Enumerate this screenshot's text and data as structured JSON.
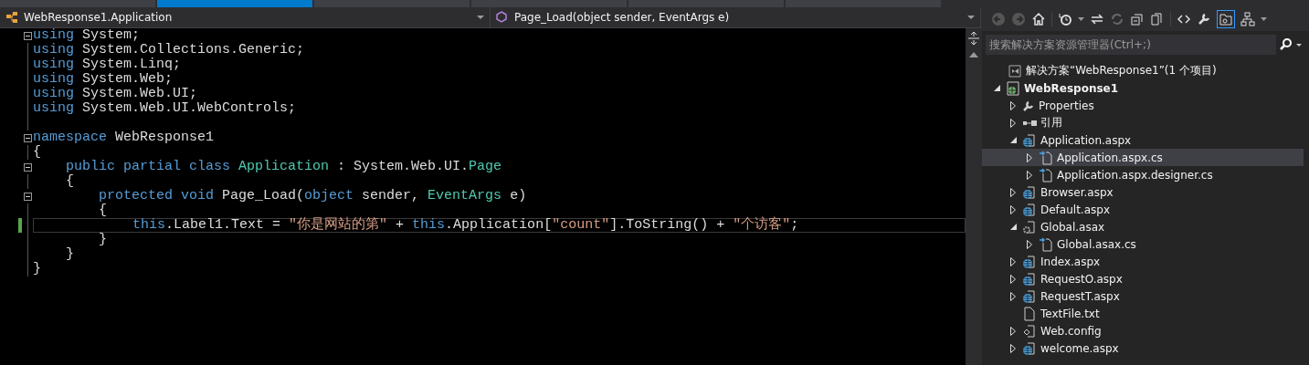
{
  "editor_tabs": [
    {
      "selected": false
    },
    {
      "selected": true
    },
    {
      "selected": false
    },
    {
      "selected": false
    },
    {
      "selected": false
    },
    {
      "selected": false
    }
  ],
  "navigation_bar": {
    "class_dropdown": "WebResponse1.Application",
    "member_dropdown": "Page_Load(object sender, EventArgs e)"
  },
  "code_lines": [
    {
      "foldable": true,
      "current": false,
      "tokens": [
        {
          "kind": "keyword",
          "text": "using"
        },
        {
          "kind": "plain",
          "text": " System;"
        }
      ]
    },
    {
      "foldable": false,
      "current": false,
      "tokens": [
        {
          "kind": "keyword",
          "text": "using"
        },
        {
          "kind": "plain",
          "text": " System.Collections.Generic;"
        }
      ]
    },
    {
      "foldable": false,
      "current": false,
      "tokens": [
        {
          "kind": "keyword",
          "text": "using"
        },
        {
          "kind": "plain",
          "text": " System.Linq;"
        }
      ]
    },
    {
      "foldable": false,
      "current": false,
      "tokens": [
        {
          "kind": "keyword",
          "text": "using"
        },
        {
          "kind": "plain",
          "text": " System.Web;"
        }
      ]
    },
    {
      "foldable": false,
      "current": false,
      "tokens": [
        {
          "kind": "keyword",
          "text": "using"
        },
        {
          "kind": "plain",
          "text": " System.Web.UI;"
        }
      ]
    },
    {
      "foldable": false,
      "current": false,
      "tokens": [
        {
          "kind": "keyword",
          "text": "using"
        },
        {
          "kind": "plain",
          "text": " System.Web.UI.WebControls;"
        }
      ]
    },
    {
      "foldable": false,
      "current": false
    },
    {
      "foldable": true,
      "current": false,
      "tokens": [
        {
          "kind": "keyword",
          "text": "namespace"
        },
        {
          "kind": "plain",
          "text": " WebResponse1"
        }
      ]
    },
    {
      "foldable": false,
      "current": false,
      "tokens": [
        {
          "kind": "plain",
          "text": "{"
        }
      ]
    },
    {
      "foldable": true,
      "current": false,
      "tokens": [
        {
          "kind": "keyword",
          "text": "    public partial class "
        },
        {
          "kind": "type",
          "text": "Application"
        },
        {
          "kind": "plain",
          "text": " : System.Web.UI."
        },
        {
          "kind": "type",
          "text": "Page"
        }
      ]
    },
    {
      "foldable": false,
      "current": false,
      "tokens": [
        {
          "kind": "plain",
          "text": "    {"
        }
      ]
    },
    {
      "foldable": true,
      "current": false,
      "tokens": [
        {
          "kind": "keyword",
          "text": "        protected void"
        },
        {
          "kind": "plain",
          "text": " Page_Load("
        },
        {
          "kind": "keyword",
          "text": "object"
        },
        {
          "kind": "plain",
          "text": " sender, "
        },
        {
          "kind": "type",
          "text": "EventArgs"
        },
        {
          "kind": "plain",
          "text": " e)"
        }
      ]
    },
    {
      "foldable": false,
      "current": false,
      "tokens": [
        {
          "kind": "plain",
          "text": "        {"
        }
      ]
    },
    {
      "foldable": false,
      "current": true,
      "tokens": [
        {
          "kind": "keyword",
          "text": "            this"
        },
        {
          "kind": "plain",
          "text": ".Label1.Text = "
        },
        {
          "kind": "string",
          "text": "\"你是网站的第\""
        },
        {
          "kind": "plain",
          "text": " + "
        },
        {
          "kind": "keyword",
          "text": "this"
        },
        {
          "kind": "plain",
          "text": ".Application["
        },
        {
          "kind": "string",
          "text": "\"count\""
        },
        {
          "kind": "plain",
          "text": "].ToString() + "
        },
        {
          "kind": "string",
          "text": "\"个访客\""
        },
        {
          "kind": "plain",
          "text": ";"
        }
      ]
    },
    {
      "foldable": false,
      "current": false,
      "tokens": [
        {
          "kind": "plain",
          "text": "        }"
        }
      ]
    },
    {
      "foldable": false,
      "current": false,
      "tokens": [
        {
          "kind": "plain",
          "text": "    }"
        }
      ]
    },
    {
      "foldable": false,
      "current": false,
      "tokens": [
        {
          "kind": "plain",
          "text": "}"
        }
      ]
    }
  ],
  "solution_explorer": {
    "search": {
      "placeholder": "搜索解决方案资源管理器(Ctrl+;)"
    },
    "tree": [
      {
        "label": "解决方案“WebResponse1”(1 个项目)",
        "kind": "solution",
        "bold": false,
        "selected": false,
        "children": [
          {
            "label": "WebResponse1",
            "kind": "project",
            "bold": true,
            "expanded": true,
            "selected": false,
            "children": [
              {
                "label": "Properties",
                "kind": "properties",
                "bold": false,
                "expanded": false,
                "selected": false
              },
              {
                "label": "引用",
                "kind": "references",
                "bold": false,
                "expanded": false,
                "selected": false
              },
              {
                "label": "Application.aspx",
                "kind": "page",
                "bold": false,
                "expanded": true,
                "selected": false,
                "children": [
                  {
                    "label": "Application.aspx.cs",
                    "kind": "code",
                    "bold": false,
                    "expanded": false,
                    "selected": true
                  },
                  {
                    "label": "Application.aspx.designer.cs",
                    "kind": "code",
                    "bold": false,
                    "expanded": false,
                    "selected": false
                  }
                ]
              },
              {
                "label": "Browser.aspx",
                "kind": "page",
                "bold": false,
                "expanded": false,
                "selected": false
              },
              {
                "label": "Default.aspx",
                "kind": "page",
                "bold": false,
                "expanded": false,
                "selected": false
              },
              {
                "label": "Global.asax",
                "kind": "global",
                "bold": false,
                "expanded": true,
                "selected": false,
                "children": [
                  {
                    "label": "Global.asax.cs",
                    "kind": "code",
                    "bold": false,
                    "expanded": false,
                    "selected": false
                  }
                ]
              },
              {
                "label": "Index.aspx",
                "kind": "page",
                "bold": false,
                "expanded": false,
                "selected": false
              },
              {
                "label": "RequestO.aspx",
                "kind": "page",
                "bold": false,
                "expanded": false,
                "selected": false
              },
              {
                "label": "RequestT.aspx",
                "kind": "page",
                "bold": false,
                "expanded": false,
                "selected": false
              },
              {
                "label": "TextFile.txt",
                "kind": "text",
                "bold": false,
                "selected": false
              },
              {
                "label": "Web.config",
                "kind": "config",
                "bold": false,
                "expanded": false,
                "selected": false
              },
              {
                "label": "welcome.aspx",
                "kind": "page",
                "bold": false,
                "expanded": false,
                "selected": false
              }
            ]
          }
        ]
      }
    ]
  }
}
